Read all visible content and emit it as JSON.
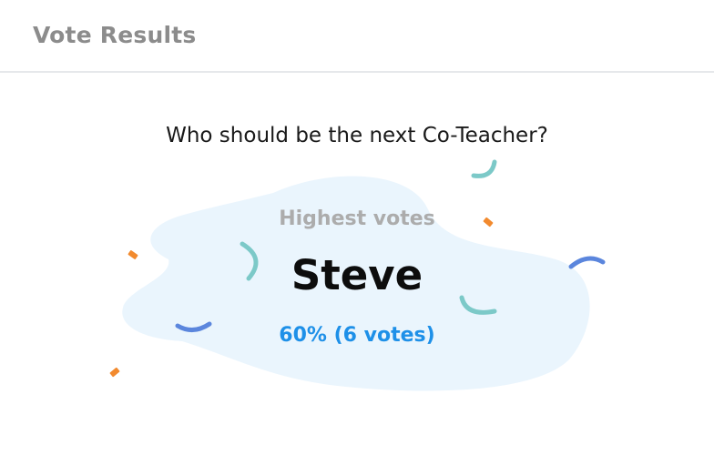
{
  "header": {
    "title": "Vote Results"
  },
  "poll": {
    "question": "Who should be the next Co-Teacher?",
    "highest_label": "Highest votes",
    "winner": "Steve",
    "winner_result": "60% (6 votes)"
  },
  "colors": {
    "blob_fill": "#eaf5fd",
    "accent_blue": "#1e90e8",
    "confetti_teal": "#7cc9c8",
    "confetti_blue": "#5b86dd",
    "confetti_orange": "#f28a2e"
  }
}
